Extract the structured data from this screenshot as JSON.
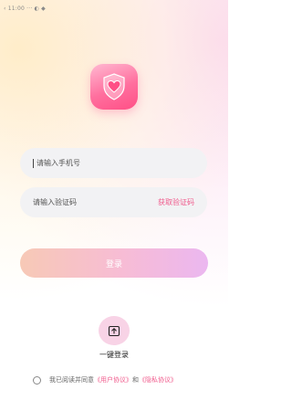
{
  "status_bar": {
    "text": "‹ 11:00 ··· ◐ ◆"
  },
  "logo": {
    "icon": "heart-shield-icon",
    "accent": "#ff6f9e"
  },
  "phone_field": {
    "placeholder": "请输入手机号"
  },
  "code_field": {
    "placeholder": "请输入验证码",
    "get_code_label": "获取验证码"
  },
  "login_button": {
    "label": "登录"
  },
  "quick_login": {
    "icon": "login-arrow-icon",
    "label": "一键登录"
  },
  "agreement": {
    "prefix": "我已阅读并同意",
    "user_agreement": "《用户协议》",
    "conjunction": "和",
    "privacy_agreement": "《隐私协议》",
    "link_color": "#f05c8d"
  }
}
